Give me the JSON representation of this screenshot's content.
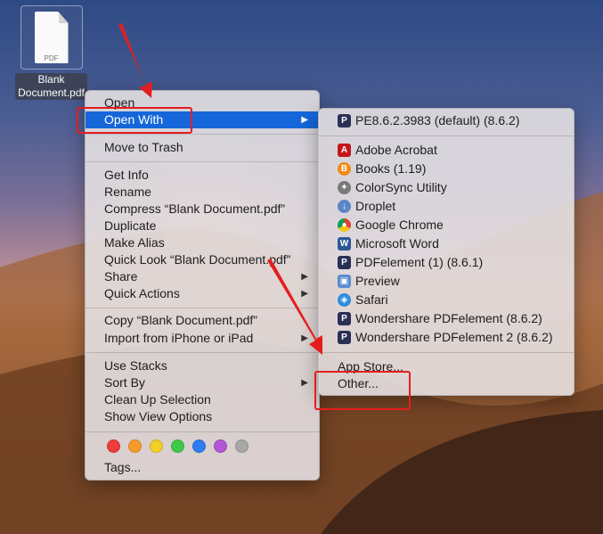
{
  "desktop": {
    "file_name_line1": "Blank",
    "file_name_line2": "Document.pdf",
    "file_type_label": "PDF"
  },
  "context_menu": {
    "items": [
      {
        "label": "Open"
      },
      {
        "label": "Open With",
        "selected": true,
        "has_submenu": true
      },
      {
        "label": "Move to Trash"
      },
      {
        "label": "Get Info"
      },
      {
        "label": "Rename"
      },
      {
        "label": "Compress “Blank Document.pdf”"
      },
      {
        "label": "Duplicate"
      },
      {
        "label": "Make Alias"
      },
      {
        "label": "Quick Look “Blank Document.pdf”"
      },
      {
        "label": "Share",
        "has_submenu": true
      },
      {
        "label": "Quick Actions",
        "has_submenu": true
      },
      {
        "label": "Copy “Blank Document.pdf”"
      },
      {
        "label": "Import from iPhone or iPad",
        "has_submenu": true
      },
      {
        "label": "Use Stacks"
      },
      {
        "label": "Sort By",
        "has_submenu": true
      },
      {
        "label": "Clean Up Selection"
      },
      {
        "label": "Show View Options"
      },
      {
        "label": "Tags..."
      }
    ],
    "tag_colors": [
      "#ee3b3b",
      "#f59a2c",
      "#f4cd26",
      "#3fc94a",
      "#2f7cf0",
      "#b455d8",
      "#a8a8a8"
    ]
  },
  "open_with_submenu": {
    "default_app": "PE8.6.2.3983 (default) (8.6.2)",
    "apps": [
      {
        "label": "Adobe Acrobat",
        "icon": "acrobat-icon"
      },
      {
        "label": "Books (1.19)",
        "icon": "books-icon"
      },
      {
        "label": "ColorSync Utility",
        "icon": "colorsync-icon"
      },
      {
        "label": "Droplet",
        "icon": "droplet-icon"
      },
      {
        "label": "Google Chrome",
        "icon": "chrome-icon"
      },
      {
        "label": "Microsoft Word",
        "icon": "word-icon"
      },
      {
        "label": "PDFelement (1) (8.6.1)",
        "icon": "pdfelement-icon"
      },
      {
        "label": "Preview",
        "icon": "preview-icon"
      },
      {
        "label": "Safari",
        "icon": "safari-icon"
      },
      {
        "label": "Wondershare PDFelement (8.6.2)",
        "icon": "pdfelement-icon"
      },
      {
        "label": "Wondershare PDFelement 2 (8.6.2)",
        "icon": "pdfelement-icon"
      }
    ],
    "app_store": "App Store...",
    "other": "Other..."
  },
  "colors": {
    "selection": "#1566d9",
    "annotation_red": "#e41e1e"
  }
}
